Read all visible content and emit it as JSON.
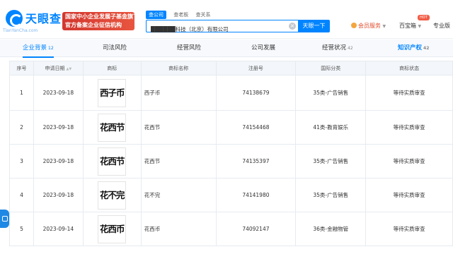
{
  "header": {
    "logo_text": "天眼查",
    "logo_domain": "TianYanCha.com",
    "promo_line1": "国家中小企业发展子基金旗下",
    "promo_line2": "官方备案企业征信机构",
    "search_tabs": [
      "查公司",
      "查老板",
      "查关系"
    ],
    "search_value": "██████科技（北京）有限公司",
    "search_button": "天眼一下",
    "vip_label": "会员服务",
    "baobao_label": "百宝箱",
    "hot_badge": "HOT",
    "edition_label": "专业版"
  },
  "tabs": [
    {
      "label": "企业背景",
      "count": "12"
    },
    {
      "label": "司法风险",
      "count": ""
    },
    {
      "label": "经营风险",
      "count": ""
    },
    {
      "label": "公司发展",
      "count": ""
    },
    {
      "label": "经营状况",
      "count": "42"
    },
    {
      "label": "知识产权",
      "count": "42"
    }
  ],
  "table": {
    "headers": [
      "序号",
      "申请日期",
      "商标",
      "商标名称",
      "注册号",
      "国际分类",
      "商标状态"
    ],
    "rows": [
      {
        "no": "1",
        "date": "2023-09-18",
        "mark": "西子币",
        "name": "西子币",
        "reg": "74138679",
        "class": "35类-广告销售",
        "status": "等待实质审查"
      },
      {
        "no": "2",
        "date": "2023-09-18",
        "mark": "花西节",
        "name": "花西节",
        "reg": "74154468",
        "class": "41类-教育娱乐",
        "status": "等待实质审查"
      },
      {
        "no": "3",
        "date": "2023-09-18",
        "mark": "花西节",
        "name": "花西节",
        "reg": "74135397",
        "class": "35类-广告销售",
        "status": "等待实质审查"
      },
      {
        "no": "4",
        "date": "2023-09-18",
        "mark": "花不完",
        "name": "花不完",
        "reg": "74141980",
        "class": "35类-广告销售",
        "status": "等待实质审查"
      },
      {
        "no": "5",
        "date": "2023-09-14",
        "mark": "花西币",
        "name": "花西币",
        "reg": "74092147",
        "class": "36类-金融物管",
        "status": "等待实质审查"
      }
    ]
  },
  "colors": {
    "brand": "#0084ff",
    "promo": "#d3362e",
    "vip": "#e14b2a"
  }
}
